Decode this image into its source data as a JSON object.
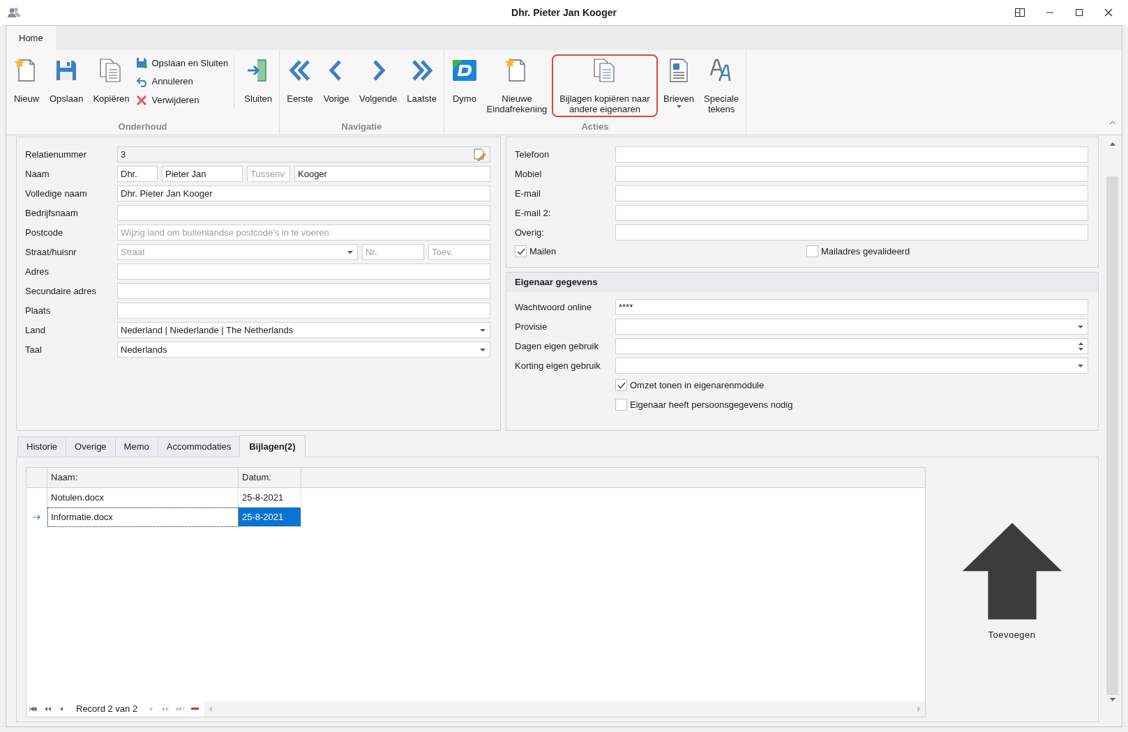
{
  "window": {
    "title": "Dhr. Pieter Jan Kooger"
  },
  "ribbon_tabs": [
    {
      "label": "Home",
      "selected": true
    }
  ],
  "ribbon_groups": [
    {
      "title": "Onderhoud",
      "items": [
        {
          "label": "Nieuw",
          "kind": "new",
          "highlighted": false,
          "dropdown": false
        },
        {
          "label": "Opslaan",
          "kind": "save",
          "highlighted": false,
          "dropdown": false
        },
        {
          "label": "Kopiëren",
          "kind": "copy",
          "highlighted": false,
          "dropdown": false
        },
        {
          "label": "Opslaan en Sluiten",
          "kind": "save-close",
          "highlighted": false,
          "dropdown": false
        },
        {
          "label": "Annuleren",
          "kind": "cancel",
          "highlighted": false,
          "dropdown": false
        },
        {
          "label": "Verwijderen",
          "kind": "delete",
          "highlighted": false,
          "dropdown": false
        },
        {
          "label": "Sluiten",
          "kind": "exit",
          "highlighted": false,
          "dropdown": false
        }
      ]
    },
    {
      "title": "Navigatie",
      "items": [
        {
          "label": "Eerste",
          "kind": "first",
          "highlighted": false,
          "dropdown": false
        },
        {
          "label": "Vorige",
          "kind": "prev",
          "highlighted": false,
          "dropdown": false
        },
        {
          "label": "Volgende",
          "kind": "next",
          "highlighted": false,
          "dropdown": false
        },
        {
          "label": "Laatste",
          "kind": "last",
          "highlighted": false,
          "dropdown": false
        }
      ]
    },
    {
      "title": "Acties",
      "items": [
        {
          "label": "Dymo",
          "kind": "dymo",
          "highlighted": false,
          "dropdown": false
        },
        {
          "label": "Nieuwe Eindafrekening",
          "kind": "new-settlement",
          "highlighted": false,
          "dropdown": false
        },
        {
          "label": "Bijlagen kopiëren naar andere eigenaren",
          "kind": "copy-attachments",
          "highlighted": true,
          "dropdown": false
        },
        {
          "label": "Brieven",
          "kind": "letters",
          "highlighted": false,
          "dropdown": true
        },
        {
          "label": "Speciale tekens",
          "kind": "special",
          "highlighted": false,
          "dropdown": false
        }
      ]
    }
  ],
  "person_form": {
    "rows": [
      {
        "label": "Relatienummer",
        "fields": [
          {
            "kind": "readonly",
            "value": "3"
          }
        ]
      },
      {
        "label": "Naam",
        "fields": [
          {
            "kind": "text",
            "value": "Dhr."
          },
          {
            "kind": "text",
            "value": "Pieter Jan"
          },
          {
            "kind": "text",
            "placeholder": "Tussenv"
          },
          {
            "kind": "text",
            "value": "Kooger"
          }
        ]
      },
      {
        "label": "Volledige naam",
        "fields": [
          {
            "kind": "text",
            "value": "Dhr. Pieter Jan Kooger"
          }
        ]
      },
      {
        "label": "Bedrijfsnaam",
        "fields": [
          {
            "kind": "text"
          }
        ]
      },
      {
        "label": "Postcode",
        "fields": [
          {
            "kind": "text",
            "placeholder": "Wijzig land om buitenlandse postcode's in te voeren"
          }
        ]
      },
      {
        "label": "Straat/huisnr",
        "fields": [
          {
            "kind": "dropdown",
            "placeholder": "Straat"
          },
          {
            "kind": "text",
            "placeholder": "Nr."
          },
          {
            "kind": "text",
            "placeholder": "Toev."
          }
        ]
      },
      {
        "label": "Adres",
        "fields": [
          {
            "kind": "text"
          }
        ]
      },
      {
        "label": "Secundaire adres",
        "fields": [
          {
            "kind": "text"
          }
        ]
      },
      {
        "label": "Plaats",
        "fields": [
          {
            "kind": "text"
          }
        ]
      },
      {
        "label": "Land",
        "fields": [
          {
            "kind": "dropdown",
            "value": "Nederland | Niederlande | The Netherlands"
          }
        ]
      },
      {
        "label": "Taal",
        "fields": [
          {
            "kind": "dropdown",
            "value": "Nederlands"
          }
        ]
      }
    ]
  },
  "contact_form": {
    "rows": [
      {
        "label": "Telefoon"
      },
      {
        "label": "Mobiel"
      },
      {
        "label": "E-mail"
      },
      {
        "label": "E-mail 2:"
      },
      {
        "label": "Overig:"
      }
    ],
    "checkboxes": [
      {
        "label": "Mailen",
        "checked": true
      },
      {
        "label": "Mailadres gevalideerd",
        "checked": false
      }
    ]
  },
  "owner_section": {
    "title": "Eigenaar gegevens",
    "rows": [
      {
        "label": "Wachtwoord online",
        "kind": "text",
        "value": "****"
      },
      {
        "label": "Provisie",
        "kind": "dropdown"
      },
      {
        "label": "Dagen eigen gebruik",
        "kind": "spin"
      },
      {
        "label": "Korting eigen gebruik",
        "kind": "dropdown"
      }
    ],
    "checkboxes": [
      {
        "label": "Omzet tonen in eigenarenmodule",
        "checked": true
      },
      {
        "label": "Eigenaar heeft persoonsgegevens nodig",
        "checked": false
      }
    ]
  },
  "tabs": [
    {
      "label": "Historie",
      "selected": false
    },
    {
      "label": "Overige",
      "selected": false
    },
    {
      "label": "Memo",
      "selected": false
    },
    {
      "label": "Accommodaties",
      "selected": false
    },
    {
      "label": "Bijlagen(2)",
      "selected": true
    }
  ],
  "attachments": {
    "columns": [
      "Naam:",
      "Datum:"
    ],
    "rows": [
      {
        "cells": [
          "Notulen.docx",
          "25-8-2021"
        ],
        "selected": false
      },
      {
        "cells": [
          "Informatie.docx",
          "25-8-2021"
        ],
        "selected": true
      }
    ],
    "navigator": "Record 2 van 2"
  },
  "add_button": {
    "label": "Toevoegen"
  }
}
